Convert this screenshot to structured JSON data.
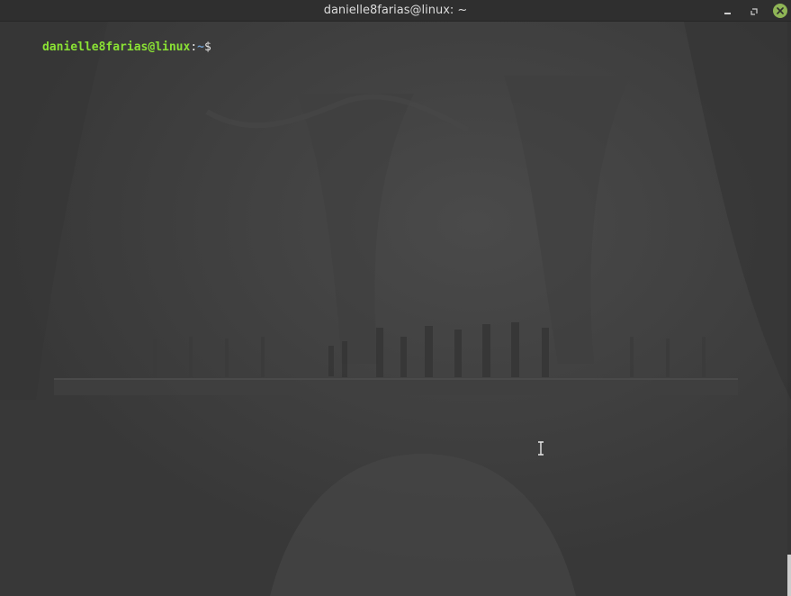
{
  "window": {
    "title": "danielle8farias@linux: ~"
  },
  "terminal": {
    "prompt": {
      "user_host": "danielle8farias@linux",
      "separator": ":",
      "cwd": "~",
      "symbol": "$"
    },
    "colors": {
      "user_host": "#8ae234",
      "cwd": "#729fcf",
      "background": "#3d3d3d"
    }
  },
  "icons": {
    "minimize": "minimize-icon",
    "maximize": "maximize-icon",
    "close": "close-icon"
  }
}
